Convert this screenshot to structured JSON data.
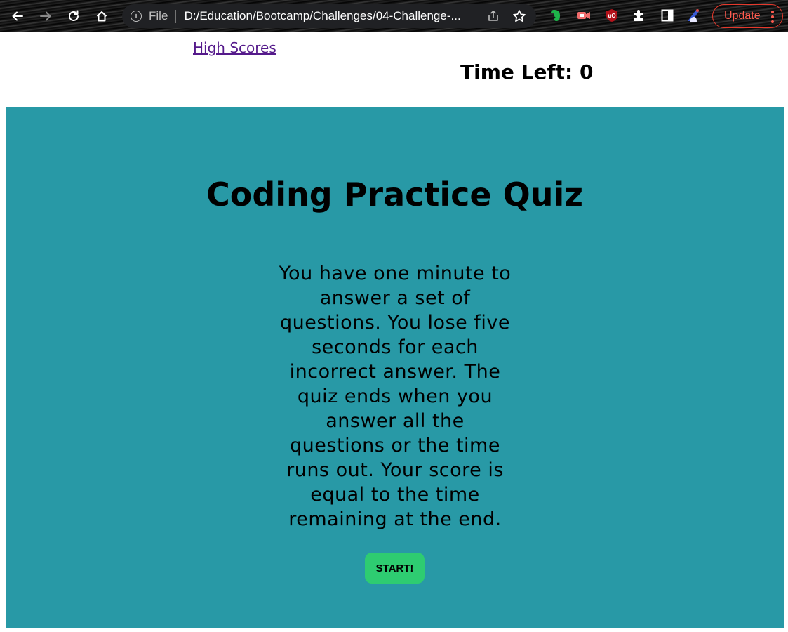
{
  "browser": {
    "address_scheme": "File",
    "address_url": "D:/Education/Bootcamp/Challenges/04-Challenge-...",
    "update_label": "Update"
  },
  "page": {
    "high_scores_link": "High Scores",
    "time_left": "Time Left: 0",
    "title": "Coding Practice Quiz",
    "description": "You have one minute to answer a set of questions. You lose five seconds for each incorrect answer. The quiz ends when you answer all the questions or the time runs out. Your score is equal to the time remaining at the end.",
    "start_button": "START!"
  },
  "colors": {
    "quiz_background": "#2899a6",
    "start_button": "#2ecc71",
    "link_visited": "#551a8b",
    "update_accent": "#e5392c"
  },
  "icons": [
    "back-arrow-icon",
    "forward-arrow-icon",
    "reload-icon",
    "home-icon",
    "info-icon",
    "share-icon",
    "bookmark-star-icon",
    "evernote-icon",
    "video-extension-icon",
    "ublock-icon",
    "puzzle-extensions-icon",
    "side-panel-icon",
    "profile-icon",
    "kebab-menu-icon"
  ]
}
